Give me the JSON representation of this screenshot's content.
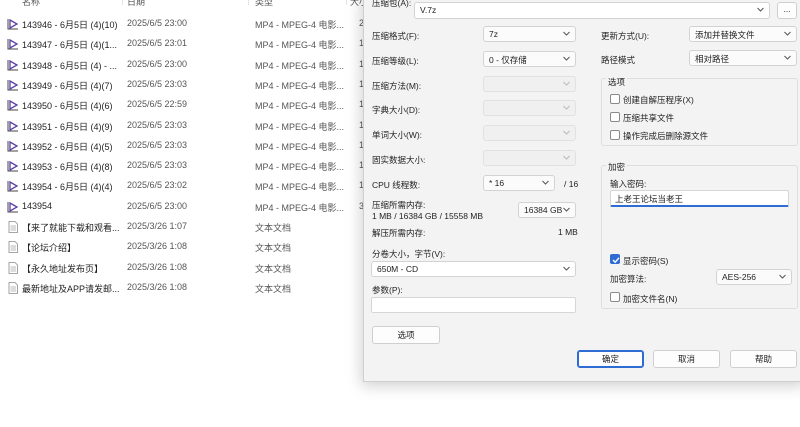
{
  "explorer": {
    "columns": {
      "name": "名称",
      "date": "日期",
      "type": "类型",
      "size": "大小"
    },
    "files": [
      {
        "name": "143946 - 6月5日 (4)(10)",
        "date": "2025/6/5 23:00",
        "type": "MP4 - MPEG-4 电影...",
        "size": "2",
        "icon": "video-file-icon"
      },
      {
        "name": "143947 - 6月5日 (4)(1...",
        "date": "2025/6/5 23:01",
        "type": "MP4 - MPEG-4 电影...",
        "size": "1",
        "icon": "video-file-icon"
      },
      {
        "name": "143948 - 6月5日 (4) - ...",
        "date": "2025/6/5 23:00",
        "type": "MP4 - MPEG-4 电影...",
        "size": "1",
        "icon": "video-file-icon"
      },
      {
        "name": "143949 - 6月5日 (4)(7)",
        "date": "2025/6/5 23:03",
        "type": "MP4 - MPEG-4 电影...",
        "size": "1",
        "icon": "video-file-icon"
      },
      {
        "name": "143950 - 6月5日 (4)(6)",
        "date": "2025/6/5 22:59",
        "type": "MP4 - MPEG-4 电影...",
        "size": "1",
        "icon": "video-file-icon"
      },
      {
        "name": "143951 - 6月5日 (4)(9)",
        "date": "2025/6/5 23:03",
        "type": "MP4 - MPEG-4 电影...",
        "size": "1",
        "icon": "video-file-icon"
      },
      {
        "name": "143952 - 6月5日 (4)(5)",
        "date": "2025/6/5 23:03",
        "type": "MP4 - MPEG-4 电影...",
        "size": "1",
        "icon": "video-file-icon"
      },
      {
        "name": "143953 - 6月5日 (4)(8)",
        "date": "2025/6/5 23:03",
        "type": "MP4 - MPEG-4 电影...",
        "size": "1",
        "icon": "video-file-icon"
      },
      {
        "name": "143954 - 6月5日 (4)(4)",
        "date": "2025/6/5 23:02",
        "type": "MP4 - MPEG-4 电影...",
        "size": "1",
        "icon": "video-file-icon"
      },
      {
        "name": "143954",
        "date": "2025/6/5 23:00",
        "type": "MP4 - MPEG-4 电影...",
        "size": "3",
        "icon": "video-file-icon"
      },
      {
        "name": "【来了就能下载和观看...",
        "date": "2025/3/26 1:07",
        "type": "文本文档",
        "size": "",
        "icon": "text-file-icon"
      },
      {
        "name": "【论坛介绍】",
        "date": "2025/3/26 1:08",
        "type": "文本文档",
        "size": "",
        "icon": "text-file-icon"
      },
      {
        "name": "【永久地址发布页】",
        "date": "2025/3/26 1:08",
        "type": "文本文档",
        "size": "",
        "icon": "text-file-icon"
      },
      {
        "name": "最新地址及APP请发邮...",
        "date": "2025/3/26 1:08",
        "type": "文本文档",
        "size": "",
        "icon": "text-file-icon"
      }
    ]
  },
  "dialog": {
    "archive_label": "压缩包(A):",
    "archive_value": "V.7z",
    "browse_label": "...",
    "left": {
      "format_label": "压缩格式(F):",
      "format_value": "7z",
      "level_label": "压缩等级(L):",
      "level_value": "0 - 仅存储",
      "method_label": "压缩方法(M):",
      "method_value": "",
      "dict_label": "字典大小(D):",
      "dict_value": "",
      "word_label": "单词大小(W):",
      "word_value": "",
      "solid_label": "固实数据大小:",
      "solid_value": "",
      "threads_label": "CPU 线程数:",
      "threads_value": "* 16",
      "threads_total": "/ 16",
      "mem_label": "压缩所需内存:",
      "mem_detail": "1 MB / 16384 GB / 15558 MB",
      "mem_value": "16384 GB",
      "decomp_label": "解压所需内存:",
      "decomp_value": "1 MB",
      "split_label": "分卷大小，字节(V):",
      "split_value": "650M - CD",
      "params_label": "参数(P):",
      "params_value": "",
      "options_button": "选项"
    },
    "right": {
      "update_label": "更新方式(U):",
      "update_value": "添加并替换文件",
      "path_label": "路径模式",
      "path_value": "相对路径",
      "options_group": "选项",
      "sfx_label": "创建自解压程序(X)",
      "sfx_checked": false,
      "shared_label": "压缩共享文件",
      "shared_checked": false,
      "delete_label": "操作完成后删除源文件",
      "delete_checked": false,
      "encrypt_group": "加密",
      "password_label": "输入密码:",
      "password_value": "上老王论坛当老王",
      "show_pwd_label": "显示密码(S)",
      "show_pwd_checked": true,
      "enc_method_label": "加密算法:",
      "enc_method_value": "AES-256",
      "enc_names_label": "加密文件名(N)",
      "enc_names_checked": false
    },
    "buttons": {
      "ok": "确定",
      "cancel": "取消",
      "help": "帮助"
    },
    "accent_color": "#2e6bd3"
  }
}
